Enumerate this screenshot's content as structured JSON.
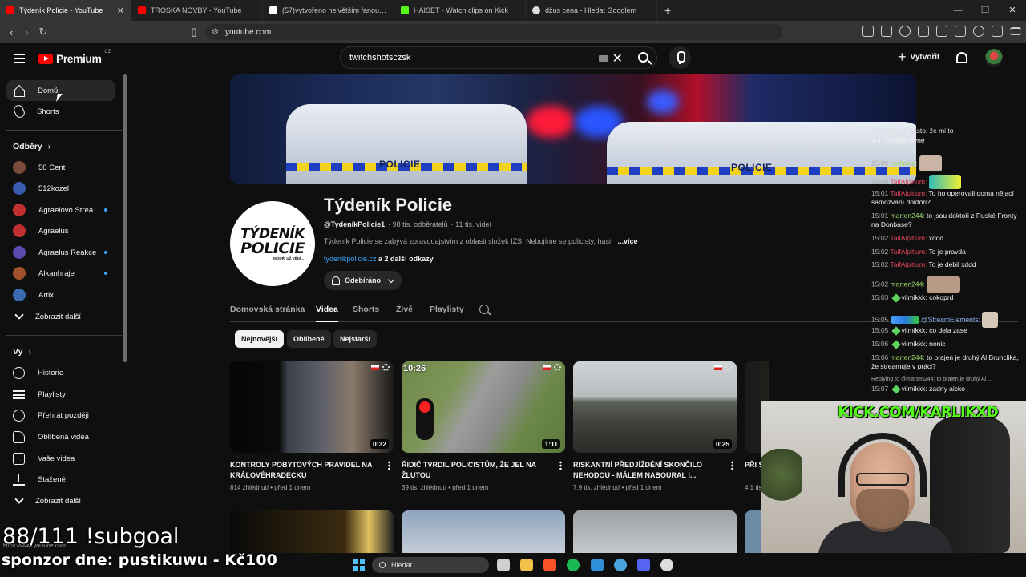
{
  "browser": {
    "tabs": [
      {
        "title": "Týdeník Policie - YouTube",
        "active": true,
        "color": "#ff0000"
      },
      {
        "title": "TROSKA NOVBY - YouTube",
        "active": false,
        "color": "#ff0000"
      },
      {
        "title": "(57)vytvořeno největším fanouškem",
        "active": false,
        "color": "#ffffff"
      },
      {
        "title": "HAISET - Watch clips on Kick",
        "active": false,
        "color": "#53fc18"
      },
      {
        "title": "džus cena - Hledat Googlem",
        "active": false,
        "color": "#dddddd"
      }
    ],
    "new_tab": "+",
    "url": "youtube.com",
    "window_controls": {
      "minimize": "—",
      "restore": "❐",
      "close": "✕"
    }
  },
  "header": {
    "brand": "Premium",
    "region": "CZ",
    "search_value": "twitchshotsczsk",
    "create_label": "Vytvořit"
  },
  "sidebar": {
    "home": "Domů",
    "shorts": "Shorts",
    "subscriptions_heading": "Odběry",
    "subscriptions": [
      {
        "name": "50 Cent",
        "color": "#7a4a3a",
        "live": false
      },
      {
        "name": "512kozel",
        "color": "#3a5ab0",
        "live": false
      },
      {
        "name": "Agraelovo Strea...",
        "color": "#c03030",
        "live": true
      },
      {
        "name": "Agraelus",
        "color": "#c03030",
        "live": false
      },
      {
        "name": "Agraelus Reakce",
        "color": "#5a4ab0",
        "live": true
      },
      {
        "name": "Alkanhraje",
        "color": "#a0502a",
        "live": true
      },
      {
        "name": "Artix",
        "color": "#3a6ab0",
        "live": false
      }
    ],
    "show_more_subs": "Zobrazit další",
    "you_heading": "Vy",
    "you_items": [
      "Historie",
      "Playlisty",
      "Přehrát později",
      "Oblíbená videa",
      "Vaše videa",
      "Stažené",
      "Zobrazit další"
    ]
  },
  "channel": {
    "banner_labels": [
      "POLICIE",
      "POLICIE"
    ],
    "avatar_line1": "TÝDENÍK",
    "avatar_line2": "POLICIE",
    "avatar_line3": "MODŘÍ UŽ VĚDÍ...",
    "name": "Týdeník Policie",
    "handle": "@TydenikPolicie1",
    "subscribers": "· 98 tis. odběratelů",
    "video_count": "· 11 tis. videí",
    "description": "Týdeník Policie se zabývá zpravodajstvím z oblasti složek IZS. Nebojíme se policisty, hasi",
    "more": "...více",
    "link": "tydenikpolicie.cz",
    "more_links": "a 2 další odkazy",
    "subscribe_label": "Odebíráno"
  },
  "channel_tabs": [
    "Domovská stránka",
    "Videa",
    "Shorts",
    "Živě",
    "Playlisty"
  ],
  "active_tab": "Videa",
  "filter_chips": [
    "Nejnovější",
    "Oblíbené",
    "Nejstarší"
  ],
  "videos": [
    {
      "title": "KONTROLY POBYTOVÝCH PRAVIDEL NA KRÁLOVÉHRADECKU",
      "views": "814 zhlédnutí",
      "age": "před 1 dnem",
      "duration": "0:32"
    },
    {
      "title": "ŘIDIČ TVRDIL POLICISTŮM, ŽE JEL NA ŽLUTOU",
      "views": "39 tis. zhlédnutí",
      "age": "před 1 dnem",
      "duration": "1:11",
      "badge": "10:26"
    },
    {
      "title": "RISKANTNÍ PŘEDJÍŽDĚNÍ SKONČILO NEHODOU - MÁLEM NABOURAL I...",
      "views": "7,9 tis. zhlédnutí",
      "age": "před 1 dnem",
      "duration": "0:25"
    },
    {
      "title": "PŘI S... KILOG...",
      "views": "4,1 tis...",
      "age": "",
      "duration": ""
    }
  ],
  "chat": {
    "messages": [
      {
        "time": "",
        "user": "",
        "text": "ani nepřijde divné"
      },
      {
        "time": "15:00",
        "user": "xodimvp:",
        "text": ""
      },
      {
        "time": "15:00",
        "user": "TaifAlpitium:",
        "text": ""
      },
      {
        "time": "15:01",
        "user": "TaifAlpitium:",
        "text": "To ho operovali doma nějací samozvaní doktoři?"
      },
      {
        "time": "15:01",
        "user": "marten244:",
        "text": "to jsou doktoři z Ruské Fronty na Donbase?"
      },
      {
        "time": "15:02",
        "user": "TaifAlpitium:",
        "text": "xddd"
      },
      {
        "time": "15:02",
        "user": "TaifAlpitium:",
        "text": "To je pravda"
      },
      {
        "time": "15:02",
        "user": "TaifAlpitium:",
        "text": "To je debil xddd"
      },
      {
        "time": "15:02",
        "user": "marten244:",
        "text": ""
      },
      {
        "time": "15:03",
        "user": "vilmikkk:",
        "text": "cokoprd"
      },
      {
        "time": "15:05",
        "user": "@StreamElements:",
        "text": ""
      },
      {
        "time": "15:05",
        "user": "vilmikkk:",
        "text": "co dela zase"
      },
      {
        "time": "15:06",
        "user": "vilmikkk:",
        "text": "nonic"
      },
      {
        "time": "15:06",
        "user": "marten244:",
        "text": "to brajen je druhý Al Brunclika, že streamuje v práci?"
      },
      {
        "time": "",
        "user": "Replying to @marten244:",
        "text": "to brajen je druhý Al ..."
      },
      {
        "time": "15:07",
        "user": "vilmikkk:",
        "text": "zadny aicko"
      }
    ],
    "top_partial": "To vidím tak často, že mi to"
  },
  "stream": {
    "kick_url": "KICK.COM/KARLIKXD",
    "subgoal": "88/111 !subgoal",
    "sponsor": "sponzor dne: pustikuwu - Kč100",
    "covered_url": "https://www.youtube.com"
  },
  "taskbar": {
    "search_placeholder": "Hledat",
    "apps": [
      {
        "name": "task-view",
        "color": "#cfcfcf"
      },
      {
        "name": "file-explorer",
        "color": "#f2c34a"
      },
      {
        "name": "brave",
        "color": "#fb542b"
      },
      {
        "name": "spotify",
        "color": "#1db954"
      },
      {
        "name": "photos",
        "color": "#2e8fd8"
      },
      {
        "name": "ccleaner",
        "color": "#4aa3df"
      },
      {
        "name": "discord",
        "color": "#5865f2"
      },
      {
        "name": "obs",
        "color": "#dddddd"
      }
    ]
  }
}
